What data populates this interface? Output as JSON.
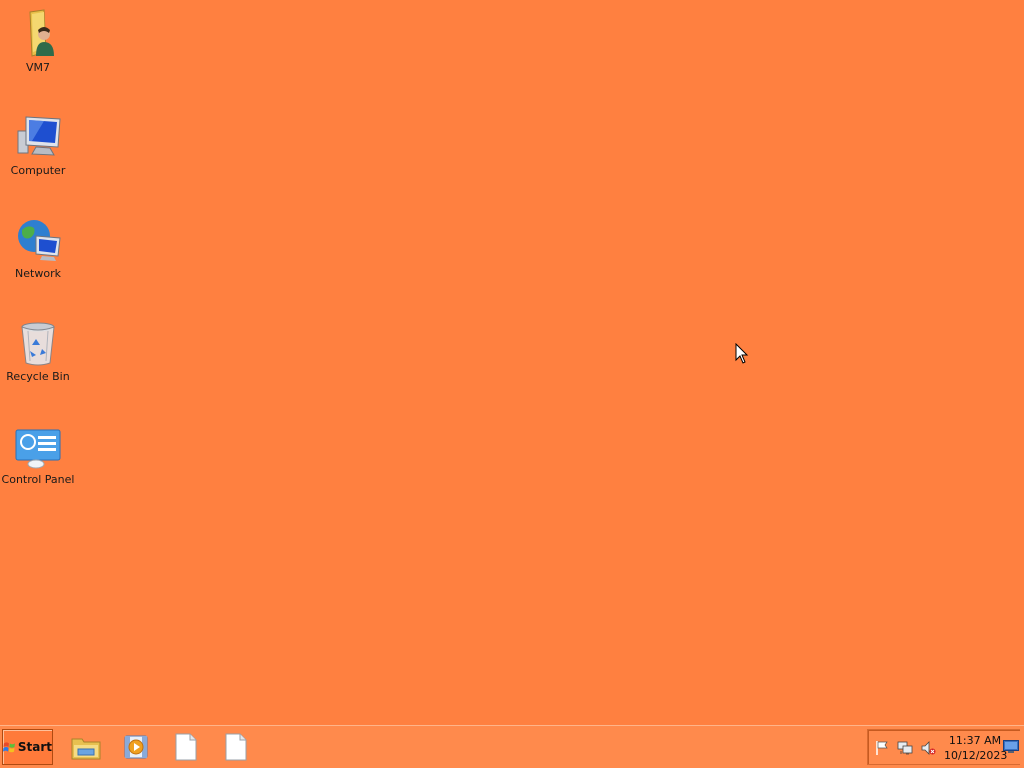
{
  "desktop": {
    "background_color": "#ff8040",
    "icons": [
      {
        "label": "VM7",
        "icon": "user-folder-icon"
      },
      {
        "label": "Computer",
        "icon": "computer-icon"
      },
      {
        "label": "Network",
        "icon": "network-icon"
      },
      {
        "label": "Recycle Bin",
        "icon": "recycle-bin-icon"
      },
      {
        "label": "Control Panel",
        "icon": "control-panel-icon"
      }
    ]
  },
  "taskbar": {
    "start_label": "Start",
    "pinned": [
      {
        "icon": "file-explorer-icon"
      },
      {
        "icon": "media-player-icon"
      },
      {
        "icon": "blank-document-icon"
      },
      {
        "icon": "blank-document-icon"
      }
    ],
    "tray": {
      "icons": [
        "action-center-flag-icon",
        "network-status-icon",
        "volume-muted-icon"
      ],
      "time": "11:37 AM",
      "date": "10/12/2023"
    },
    "show_desktop_icon": "show-desktop-icon"
  }
}
